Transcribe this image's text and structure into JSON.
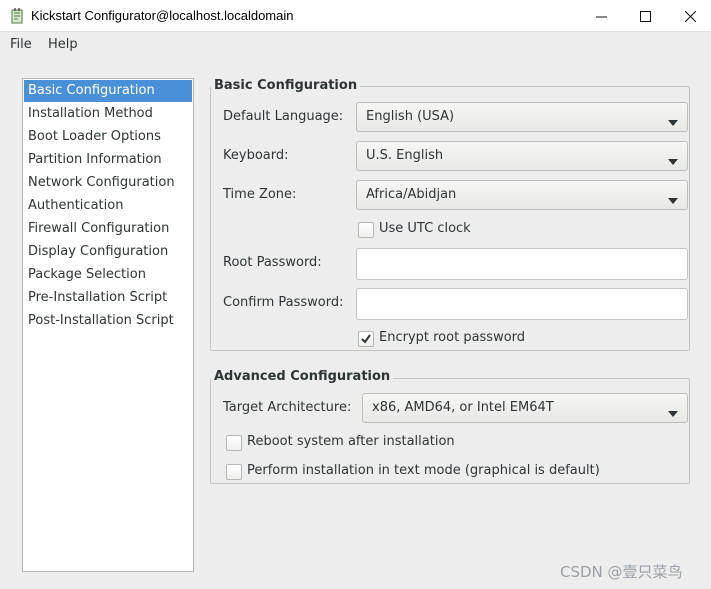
{
  "window": {
    "title": "Kickstart Configurator@localhost.localdomain",
    "icons": [
      "app-icon",
      "minimize-icon",
      "maximize-icon",
      "close-icon"
    ]
  },
  "menu": {
    "file": "File",
    "help": "Help"
  },
  "sidebar": {
    "selected_index": 0,
    "items": [
      {
        "label": "Basic Configuration"
      },
      {
        "label": "Installation Method"
      },
      {
        "label": "Boot Loader Options"
      },
      {
        "label": "Partition Information"
      },
      {
        "label": "Network Configuration"
      },
      {
        "label": "Authentication"
      },
      {
        "label": "Firewall Configuration"
      },
      {
        "label": "Display Configuration"
      },
      {
        "label": "Package Selection"
      },
      {
        "label": "Pre-Installation Script"
      },
      {
        "label": "Post-Installation Script"
      }
    ]
  },
  "basic": {
    "title": "Basic Configuration",
    "language_label": "Default Language:",
    "language_value": "English (USA)",
    "keyboard_label": "Keyboard:",
    "keyboard_value": "U.S. English",
    "timezone_label": "Time Zone:",
    "timezone_value": "Africa/Abidjan",
    "utc_label": "Use UTC clock",
    "utc_checked": false,
    "root_password_label": "Root Password:",
    "root_password_value": "",
    "confirm_password_label": "Confirm Password:",
    "confirm_password_value": "",
    "encrypt_label": "Encrypt root password",
    "encrypt_checked": true
  },
  "advanced": {
    "title": "Advanced Configuration",
    "arch_label": "Target Architecture:",
    "arch_value": "x86, AMD64, or Intel EM64T",
    "reboot_label": "Reboot system after installation",
    "reboot_checked": false,
    "textmode_label": "Perform installation in text mode (graphical is default)",
    "textmode_checked": false
  },
  "watermark": "CSDN @壹只菜鸟",
  "colors": {
    "selection": "#4a90d9",
    "window_bg": "#ededed",
    "text": "#2e3436"
  }
}
